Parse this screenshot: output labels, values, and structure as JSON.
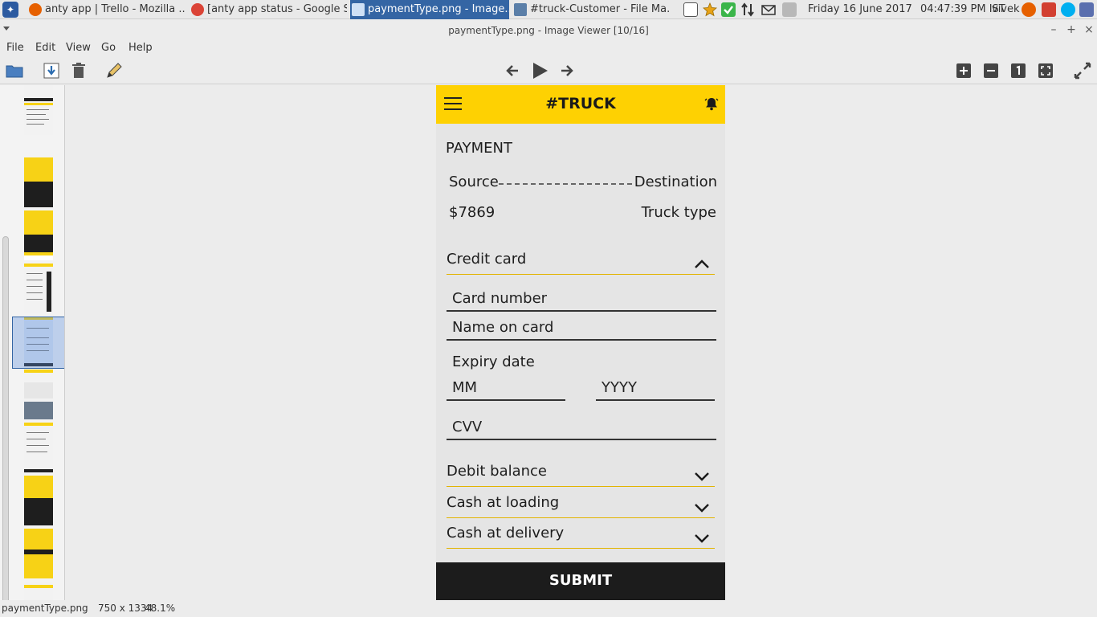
{
  "taskbar": {
    "tasks": [
      {
        "label": "anty app | Trello - Mozilla ..."
      },
      {
        "label": "[anty app status - Google S..."
      },
      {
        "label": "paymentType.png - Image..."
      },
      {
        "label": "#truck-Customer - File Ma..."
      }
    ],
    "date": "Friday 16 June 2017",
    "time": "04:47:39 PM IST",
    "user": "vivek"
  },
  "window": {
    "title": "paymentType.png - Image Viewer [10/16]"
  },
  "menu": {
    "file": "File",
    "edit": "Edit",
    "view": "View",
    "go": "Go",
    "help": "Help"
  },
  "app": {
    "title": "#TRUCK",
    "heading": "PAYMENT",
    "source": "Source",
    "destination": "Destination",
    "price": "$7869",
    "truck_type": "Truck type",
    "credit_card": "Credit card",
    "card_number": "Card number",
    "name_on_card": "Name on card",
    "expiry_date": "Expiry date",
    "mm": "MM",
    "yyyy": "YYYY",
    "cvv": "CVV",
    "debit_balance": "Debit balance",
    "cash_loading": "Cash at loading",
    "cash_delivery": "Cash at delivery",
    "submit": "SUBMIT"
  },
  "status": {
    "file": "paymentType.png",
    "dimensions": "750 x 1334",
    "zoom": "48.1%"
  },
  "colors": {
    "accent_yellow": "#fed102",
    "dark": "#1c1c1c"
  }
}
